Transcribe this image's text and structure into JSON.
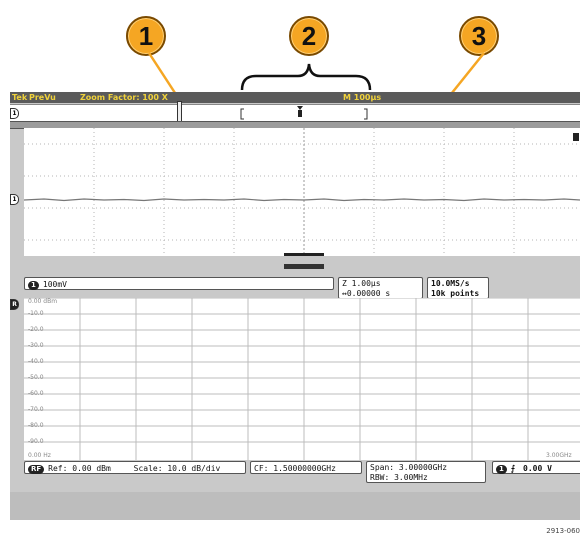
{
  "callouts": [
    "1",
    "2",
    "3"
  ],
  "topbar": {
    "brand": "Tek",
    "mode": "PreVu",
    "zoom_label": "Zoom Factor: 100 X",
    "timebase": "M 100µs"
  },
  "channel_readout": {
    "channel": "1",
    "scale": "100mV"
  },
  "zoom_readout": {
    "line1": "Z 1.00µs",
    "line2": "↔0.00000 s"
  },
  "sample_readout": {
    "line1": "10.0MS/s",
    "line2": "10k points"
  },
  "spectrum": {
    "db_labels": [
      "0.00 dBm",
      "-10.0",
      "-20.0",
      "-30.0",
      "-40.0",
      "-50.0",
      "-60.0",
      "-70.0",
      "-80.0",
      "-90.0"
    ],
    "freq_start": "0.00 Hz",
    "freq_end": "3.00GHz"
  },
  "bottom": {
    "ref": "Ref: 0.00 dBm",
    "scale": "Scale: 10.0 dB/div",
    "cf": "CF: 1.50000000GHz",
    "span": "Span:  3.00000GHz",
    "rbw": "RBW:   3.00MHz",
    "trigger_level": "0.00 V"
  },
  "figure_number": "2913-060"
}
